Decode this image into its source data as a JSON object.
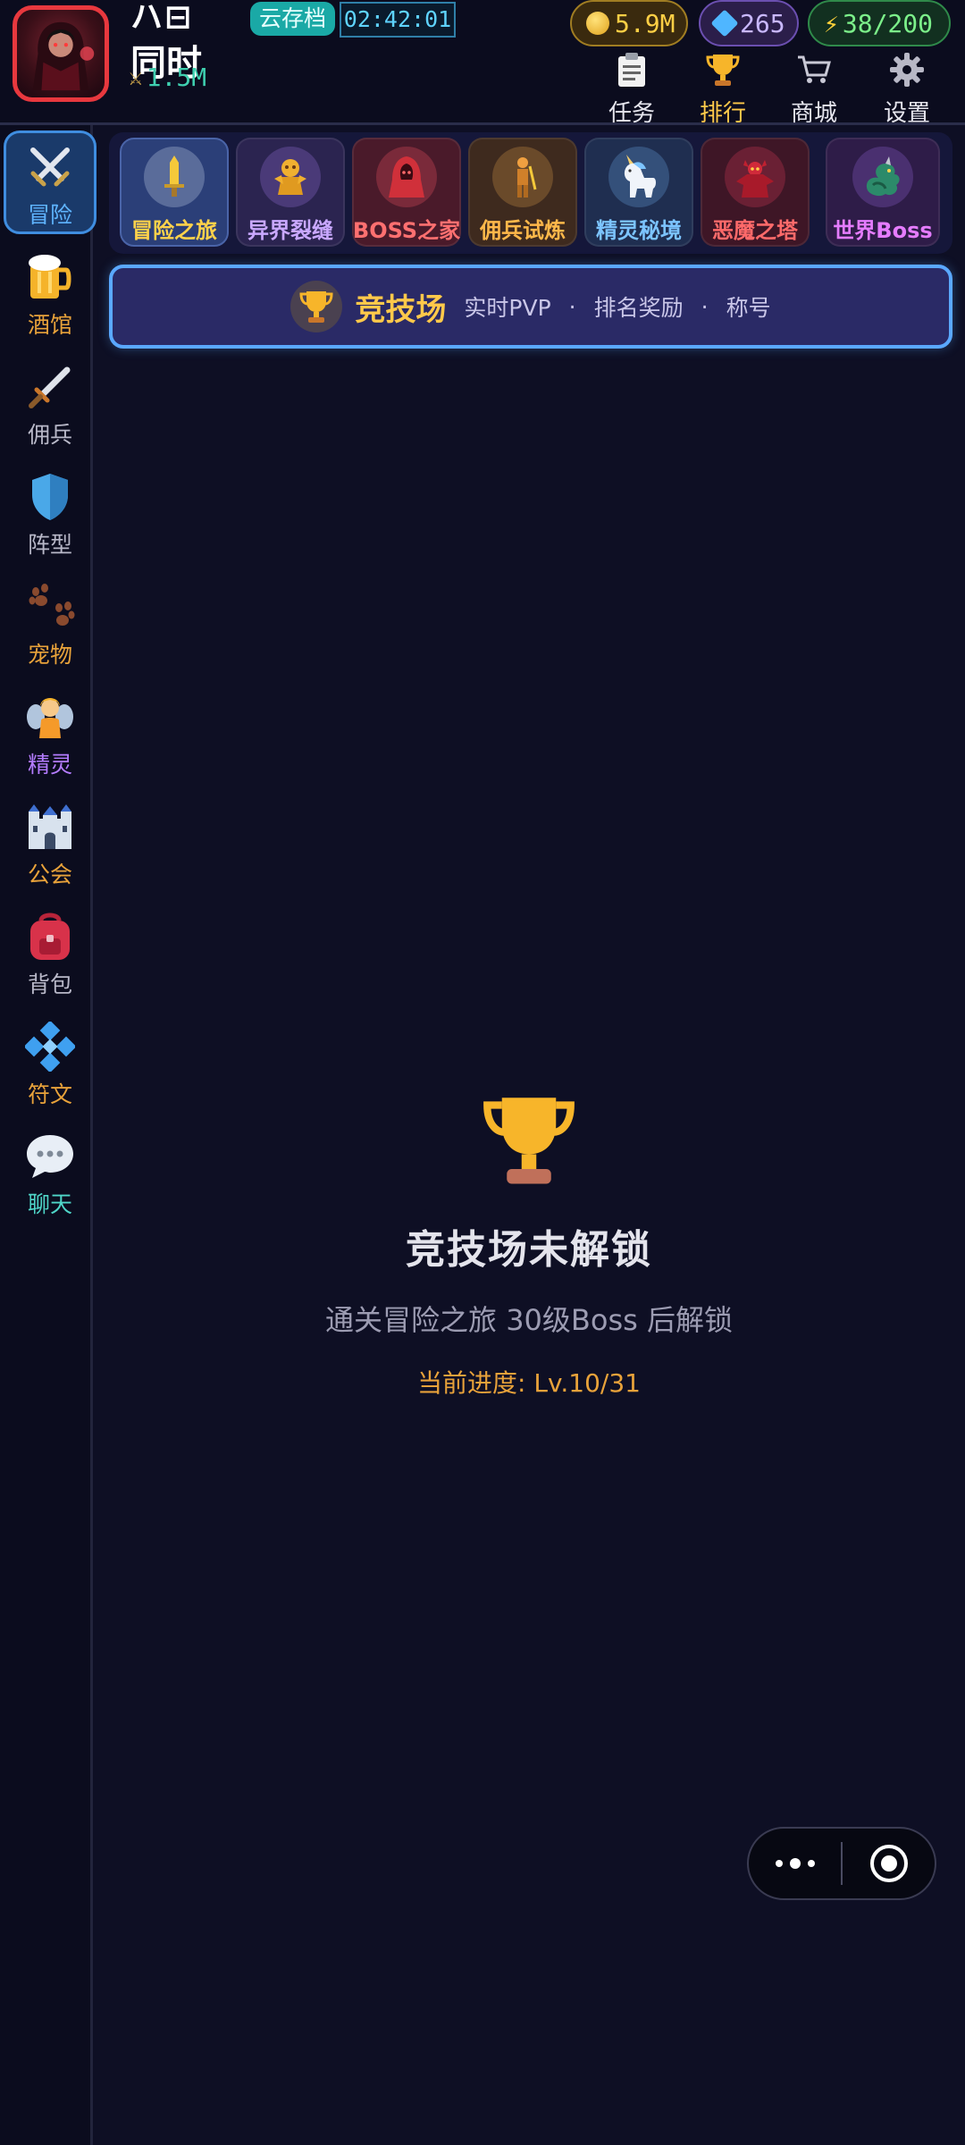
{
  "header": {
    "player_name": "ハ⊟ᄼ⸝k",
    "subtitle": "同时",
    "cloud_save": "云存档",
    "timer": "02:42:01",
    "power": "1.5M",
    "resources": {
      "gold": "5.9M",
      "gems": "265",
      "energy": "38/200"
    },
    "nav": [
      {
        "label": "任务",
        "icon": "clipboard-icon"
      },
      {
        "label": "排行",
        "icon": "trophy-icon"
      },
      {
        "label": "商城",
        "icon": "cart-icon"
      },
      {
        "label": "设置",
        "icon": "gear-icon"
      }
    ]
  },
  "sidebar": {
    "items": [
      {
        "label": "冒险",
        "icon": "crossed-swords-icon",
        "color": "#5fb4ff"
      },
      {
        "label": "酒馆",
        "icon": "beer-mug-icon",
        "color": "#e8a23a"
      },
      {
        "label": "佣兵",
        "icon": "dagger-icon",
        "color": "#b8b8c8"
      },
      {
        "label": "阵型",
        "icon": "shield-icon",
        "color": "#b8b8c8"
      },
      {
        "label": "宠物",
        "icon": "paw-prints-icon",
        "color": "#e8a23a"
      },
      {
        "label": "精灵",
        "icon": "fairy-icon",
        "color": "#b47cff"
      },
      {
        "label": "公会",
        "icon": "castle-icon",
        "color": "#e8a23a"
      },
      {
        "label": "背包",
        "icon": "backpack-icon",
        "color": "#b8b8c8"
      },
      {
        "label": "符文",
        "icon": "rune-diamond-icon",
        "color": "#e8a23a"
      },
      {
        "label": "聊天",
        "icon": "chat-bubble-icon",
        "color": "#4fd6c8"
      }
    ]
  },
  "tabs": [
    {
      "label": "冒险之旅",
      "icon": "golden-sword-icon",
      "color": "#ffd24a",
      "bg": "#2b3f78"
    },
    {
      "label": "异界裂缝",
      "icon": "golden-idol-icon",
      "color": "#c9a8ff",
      "bg": "#2b2450"
    },
    {
      "label": "BOSS之家",
      "icon": "red-hooded-boss-icon",
      "color": "#ff7070",
      "bg": "#4a1a2a"
    },
    {
      "label": "佣兵试炼",
      "icon": "mercenary-figure-icon",
      "color": "#ffb84a",
      "bg": "#3e2a1e"
    },
    {
      "label": "精灵秘境",
      "icon": "unicorn-icon",
      "color": "#7cc4ff",
      "bg": "#1f2e50"
    },
    {
      "label": "恶魔之塔",
      "icon": "demon-icon",
      "color": "#ff6a6a",
      "bg": "#3e1626"
    },
    {
      "label": "世界Boss",
      "icon": "dragon-icon",
      "color": "#e57cff",
      "bg": "#2e1c48"
    }
  ],
  "arena": {
    "title": "竞技场",
    "tags": [
      "实时PVP",
      "排名奖励",
      "称号"
    ],
    "separator": "·"
  },
  "locked": {
    "title": "竞技场未解锁",
    "description": "通关冒险之旅 30级Boss 后解锁",
    "progress": "当前进度: Lv.10/31"
  },
  "capsule": {
    "more_icon": "more-dots-icon",
    "close_icon": "target-close-icon"
  }
}
